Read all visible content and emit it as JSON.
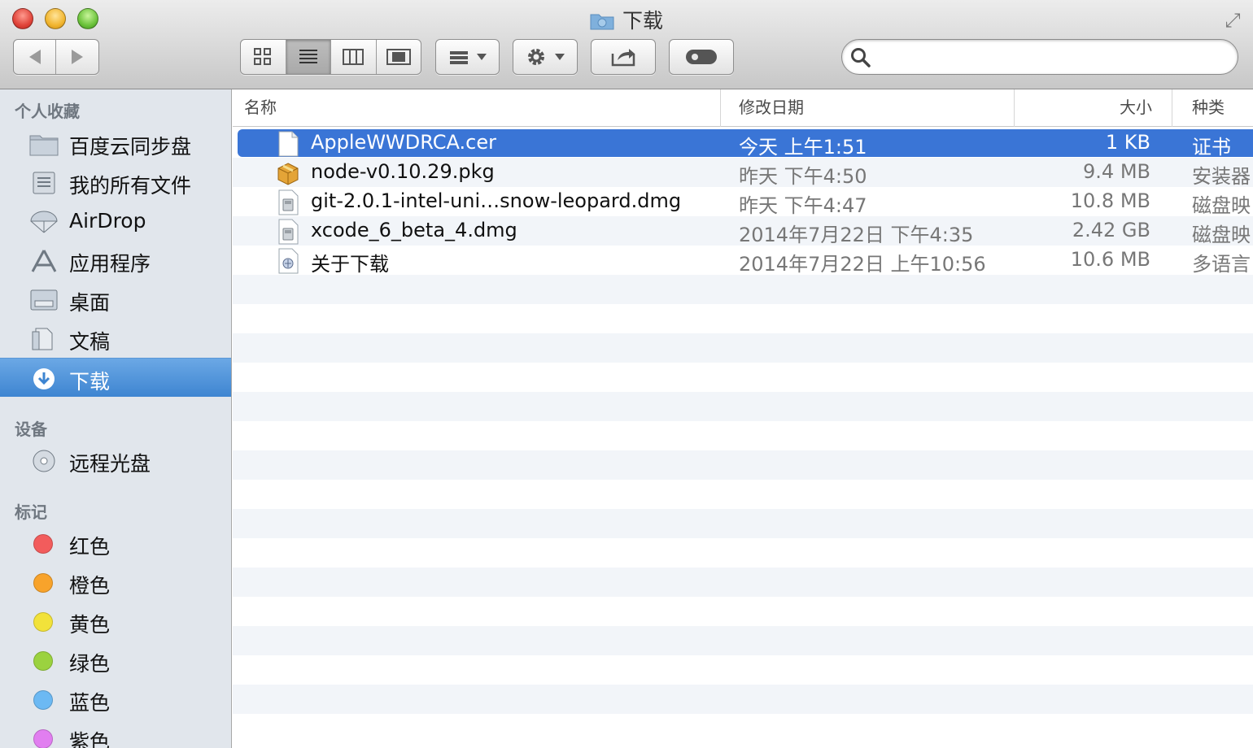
{
  "window": {
    "title": "下载"
  },
  "toolbar": {
    "back": "back",
    "forward": "forward",
    "views": [
      "icon-view",
      "list-view",
      "column-view",
      "coverflow-view"
    ],
    "search": {
      "placeholder": "",
      "value": ""
    }
  },
  "sidebar": {
    "sections": {
      "favorites": "个人收藏",
      "devices": "设备",
      "tags": "标记"
    },
    "favorites": [
      {
        "label": "百度云同步盘",
        "icon": "folder-icon"
      },
      {
        "label": "我的所有文件",
        "icon": "all-files-icon"
      },
      {
        "label": "AirDrop",
        "icon": "airdrop-icon"
      },
      {
        "label": "应用程序",
        "icon": "applications-icon"
      },
      {
        "label": "桌面",
        "icon": "desktop-icon"
      },
      {
        "label": "文稿",
        "icon": "documents-icon"
      },
      {
        "label": "下载",
        "icon": "downloads-icon",
        "selected": true
      }
    ],
    "devices": [
      {
        "label": "远程光盘",
        "icon": "remote-disc-icon"
      }
    ],
    "tags": [
      {
        "label": "红色",
        "color": "#f25c5c"
      },
      {
        "label": "橙色",
        "color": "#f8a32b"
      },
      {
        "label": "黄色",
        "color": "#f2e23a"
      },
      {
        "label": "绿色",
        "color": "#9bd23f"
      },
      {
        "label": "蓝色",
        "color": "#6cb9f3"
      },
      {
        "label": "紫色",
        "color": "#e17ef0"
      }
    ]
  },
  "columns": {
    "name": "名称",
    "date": "修改日期",
    "size": "大小",
    "kind": "种类"
  },
  "files": [
    {
      "name": "AppleWWDRCA.cer",
      "date": "今天 上午1:51",
      "size": "1 KB",
      "kind": "证书",
      "icon": "certificate-file-icon",
      "selected": true
    },
    {
      "name": "node-v0.10.29.pkg",
      "date": "昨天 下午4:50",
      "size": "9.4 MB",
      "kind": "安装器",
      "icon": "package-icon"
    },
    {
      "name": "git-2.0.1-intel-uni…snow-leopard.dmg",
      "date": "昨天 下午4:47",
      "size": "10.8 MB",
      "kind": "磁盘映",
      "icon": "disk-image-icon"
    },
    {
      "name": "xcode_6_beta_4.dmg",
      "date": "2014年7月22日 下午4:35",
      "size": "2.42 GB",
      "kind": "磁盘映",
      "icon": "disk-image-icon"
    },
    {
      "name": "关于下载",
      "date": "2014年7月22日 上午10:56",
      "size": "10.6 MB",
      "kind": "多语言",
      "icon": "localized-file-icon"
    }
  ],
  "colors": {
    "selection": "#3a75d6",
    "sidebar_bg": "#e1e6ec",
    "stripe": "#f2f5f9"
  }
}
